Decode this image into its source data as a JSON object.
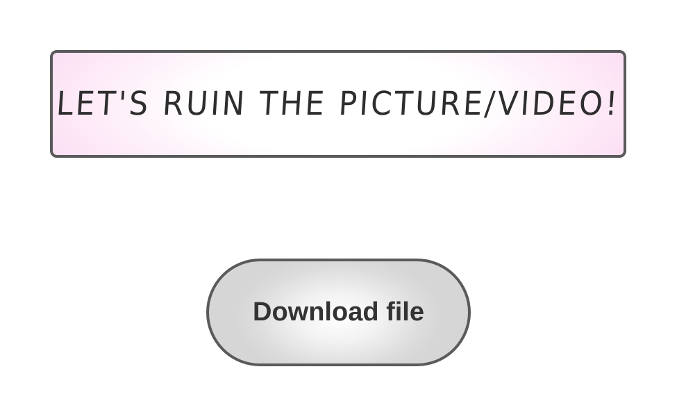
{
  "banner": {
    "title": "LET'S RUIN THE PICTURE/VIDEO!"
  },
  "actions": {
    "download_label": "Download file"
  },
  "colors": {
    "banner_border": "#5a5a5a",
    "banner_gradient_edge": "#f9d2ef",
    "text": "#2e2e2e",
    "button_fill": "#d6d6d6"
  }
}
